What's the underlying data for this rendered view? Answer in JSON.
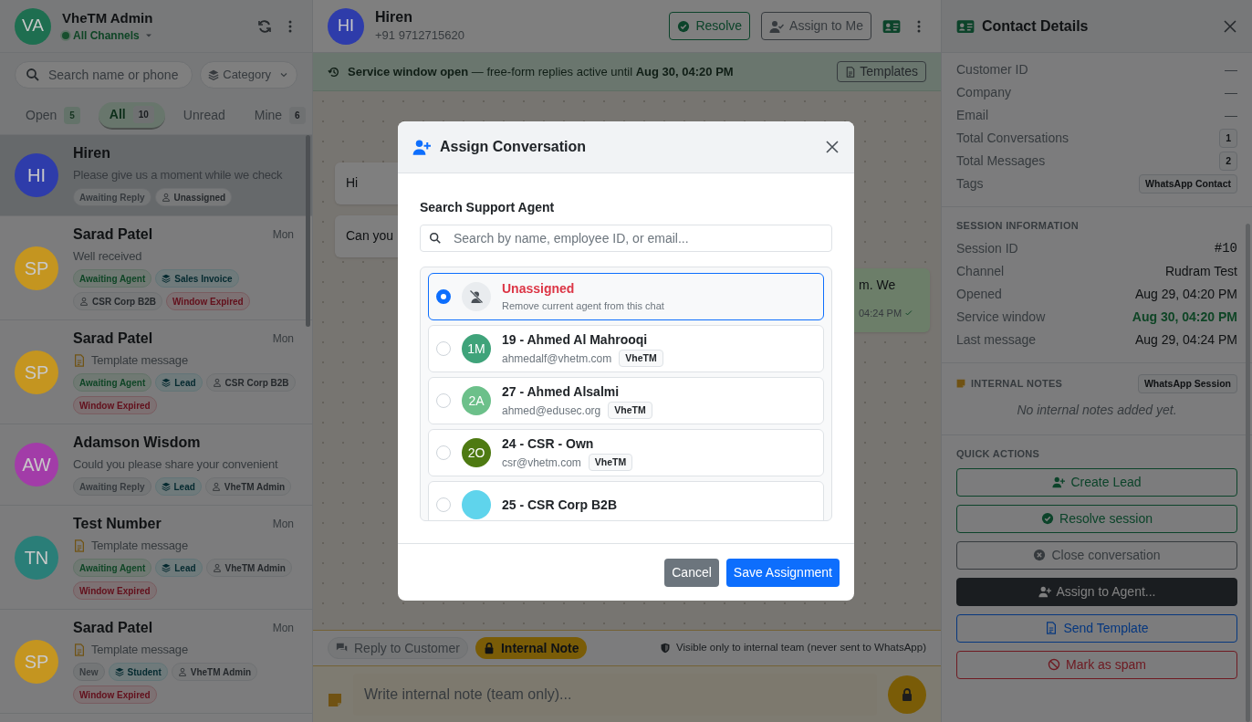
{
  "sidebar": {
    "user": {
      "initials": "VA",
      "name": "VheTM Admin",
      "channel": "All Channels",
      "color": "#1e6e50"
    },
    "search": {
      "placeholder": "Search name or phone"
    },
    "category": "Category",
    "tabs": [
      {
        "label": "Open",
        "count": "5",
        "selected": false
      },
      {
        "label": "All",
        "count": "10",
        "selected": true
      },
      {
        "label": "Unread",
        "selected": false
      },
      {
        "label": "Mine",
        "count": "6",
        "selected": false
      }
    ],
    "conversations": [
      {
        "initials": "HI",
        "color": "#2e3caa",
        "name": "Hiren",
        "preview": "Please give us a moment while we check",
        "template": false,
        "selected": true,
        "tags": [
          {
            "kind": "status",
            "label": "Awaiting Reply"
          },
          {
            "kind": "agent",
            "label": "Unassigned"
          }
        ]
      },
      {
        "initials": "SP",
        "color": "#c49520",
        "name": "Sarad Patel",
        "time": "Mon",
        "preview": "Well received",
        "template": false,
        "selected": false,
        "tags": [
          {
            "kind": "waiting",
            "label": "Awaiting Agent"
          },
          {
            "kind": "category",
            "label": "Sales Invoice"
          },
          {
            "kind": "agent",
            "label": "CSR Corp B2B"
          },
          {
            "kind": "expired",
            "label": "Window Expired"
          }
        ]
      },
      {
        "initials": "SP",
        "color": "#c49520",
        "name": "Sarad Patel",
        "time": "Mon",
        "preview": "Template message",
        "template": true,
        "selected": false,
        "tags": [
          {
            "kind": "waiting",
            "label": "Awaiting Agent"
          },
          {
            "kind": "category",
            "label": "Lead"
          },
          {
            "kind": "agent",
            "label": "CSR Corp B2B"
          },
          {
            "kind": "expired",
            "label": "Window Expired"
          }
        ]
      },
      {
        "initials": "AW",
        "color": "#a23ca8",
        "name": "Adamson Wisdom",
        "preview": "Could you please share your convenient",
        "template": false,
        "selected": false,
        "tags": [
          {
            "kind": "status",
            "label": "Awaiting Reply"
          },
          {
            "kind": "category",
            "label": "Lead"
          },
          {
            "kind": "agent",
            "label": "VheTM Admin"
          }
        ]
      },
      {
        "initials": "TN",
        "color": "#2a7e78",
        "name": "Test Number",
        "time": "Mon",
        "preview": "Template message",
        "template": true,
        "selected": false,
        "tags": [
          {
            "kind": "waiting",
            "label": "Awaiting Agent"
          },
          {
            "kind": "category",
            "label": "Lead"
          },
          {
            "kind": "agent",
            "label": "VheTM Admin"
          },
          {
            "kind": "expired",
            "label": "Window Expired"
          }
        ]
      },
      {
        "initials": "SP",
        "color": "#c49520",
        "name": "Sarad Patel",
        "time": "Mon",
        "preview": "Template message",
        "template": true,
        "selected": false,
        "tags": [
          {
            "kind": "status",
            "label": "New"
          },
          {
            "kind": "category",
            "label": "Student"
          },
          {
            "kind": "agent",
            "label": "VheTM Admin"
          },
          {
            "kind": "expired",
            "label": "Window Expired"
          }
        ]
      }
    ]
  },
  "chat": {
    "contact": {
      "initials": "HI",
      "color": "#2e3caa",
      "name": "Hiren",
      "phone": "+91 9712715620"
    },
    "actions": [
      {
        "kind": "resolve",
        "label": "Resolve"
      },
      {
        "kind": "assign",
        "label": "Assign to Me"
      }
    ],
    "banner": {
      "text": "**Service window open** — free-form replies active until **Aug 30, 04:20 PM**",
      "button": "Templates"
    },
    "messages": [
      {
        "kind": "incoming",
        "text": "Hi"
      },
      {
        "kind": "incoming",
        "text": "Can you"
      },
      {
        "kind": "outgoing",
        "text": "m. We",
        "time": "04:24 PM"
      }
    ],
    "modes": [
      {
        "label": "Reply to Customer",
        "selected": false
      },
      {
        "label": "Internal Note",
        "selected": true
      }
    ],
    "visibility_note": "Visible only to internal team (never sent to WhatsApp)",
    "composer": {
      "placeholder": "Write internal note (team only)..."
    }
  },
  "details": {
    "title": "Contact Details",
    "rows": [
      {
        "label": "Customer ID",
        "value": "—",
        "kind": "dash"
      },
      {
        "label": "Company",
        "value": "—",
        "kind": "dash"
      },
      {
        "label": "Email",
        "value": "—",
        "kind": "dash"
      },
      {
        "label": "Total Conversations",
        "value": "1",
        "kind": "badge"
      },
      {
        "label": "Total Messages",
        "value": "2",
        "kind": "badge"
      },
      {
        "label": "Tags",
        "value": "WhatsApp Contact",
        "kind": "badge"
      }
    ],
    "session": {
      "heading": "SESSION INFORMATION",
      "rows": [
        {
          "label": "Session ID",
          "value": "#10",
          "kind": "mono"
        },
        {
          "label": "Channel",
          "value": "Rudram Test",
          "kind": "text"
        },
        {
          "label": "Opened",
          "value": "Aug 29, 04:20 PM",
          "kind": "text"
        },
        {
          "label": "Service window",
          "value": "Aug 30, 04:20 PM",
          "kind": "highlight"
        },
        {
          "label": "Last message",
          "value": "Aug 29, 04:24 PM",
          "kind": "text"
        }
      ]
    },
    "notes": {
      "heading": "INTERNAL NOTES",
      "badge": "WhatsApp Session",
      "empty": "No internal notes added yet."
    },
    "quick_actions": {
      "heading": "QUICK ACTIONS",
      "buttons": [
        {
          "kind": "create-lead",
          "label": "Create Lead"
        },
        {
          "kind": "resolve",
          "label": "Resolve session"
        },
        {
          "kind": "close",
          "label": "Close conversation"
        },
        {
          "kind": "assign",
          "label": "Assign to Agent..."
        },
        {
          "kind": "template",
          "label": "Send Template"
        },
        {
          "kind": "spam",
          "label": "Mark as spam"
        }
      ]
    }
  },
  "modal": {
    "title": "Assign Conversation",
    "label": "Search Support Agent",
    "search": {
      "placeholder": "Search by name, employee ID, or email..."
    },
    "options": [
      {
        "kind": "unassigned",
        "name": "Unassigned",
        "subtitle": "Remove current agent from this chat",
        "selected": true
      },
      {
        "kind": "agent",
        "initials": "1M",
        "color": "#3fa37a",
        "name": "19 - Ahmed Al Mahrooqi",
        "email": "ahmedalf@vhetm.com",
        "org": "VheTM",
        "selected": false
      },
      {
        "kind": "agent",
        "initials": "2A",
        "color": "#6cc08a",
        "name": "27 - Ahmed Alsalmi",
        "email": "ahmed@edusec.org",
        "org": "VheTM",
        "selected": false
      },
      {
        "kind": "agent",
        "initials": "2O",
        "color": "#4e7a12",
        "name": "24 - CSR - Own",
        "email": "csr@vhetm.com",
        "org": "VheTM",
        "selected": false
      },
      {
        "kind": "agent",
        "color": "#5fd4ec",
        "name": "25 - CSR Corp B2B",
        "selected": false
      }
    ],
    "buttons": [
      {
        "kind": "cancel",
        "label": "Cancel"
      },
      {
        "kind": "save",
        "label": "Save Assignment"
      }
    ]
  }
}
